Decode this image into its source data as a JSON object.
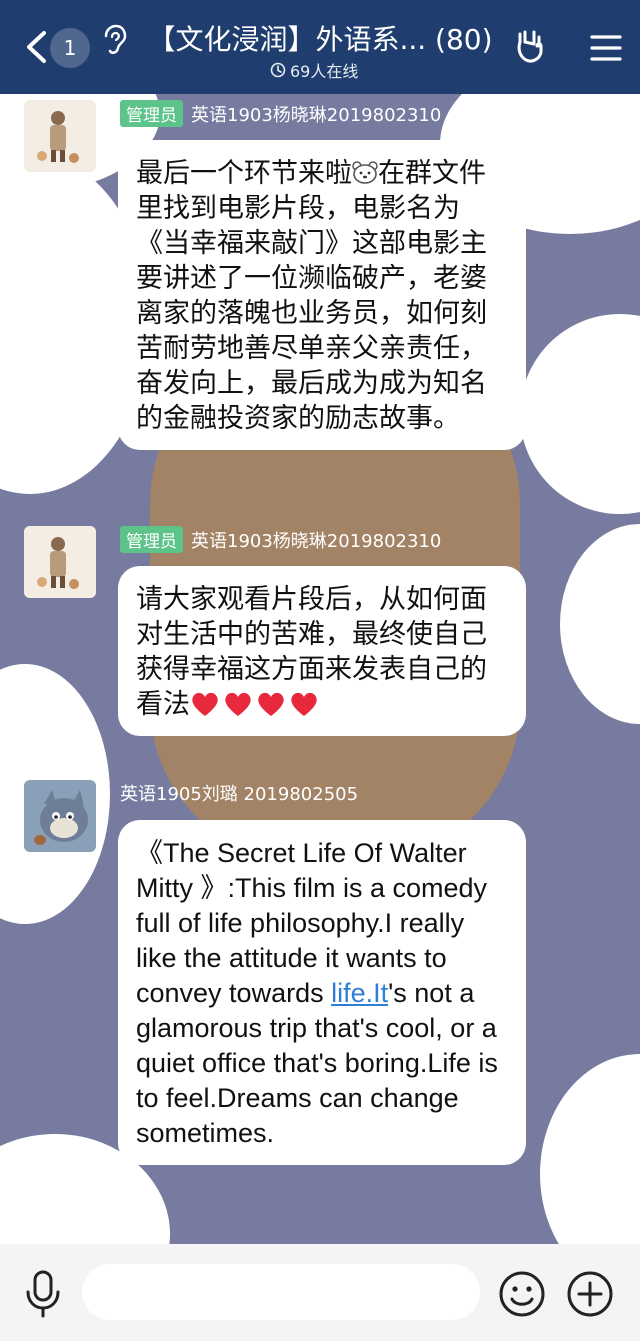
{
  "header": {
    "unread_count": "1",
    "title": "【文化浸润】外语系... (80)",
    "online_status": "69人在线"
  },
  "messages": [
    {
      "admin_badge": "管理员",
      "sender": "英语1903杨晓琳2019802310",
      "text_part1": "最后一个环节来啦",
      "text_part2": "在群文件里找到电影片段，电影名为《当幸福来敲门》这部电影主要讲述了一位濒临破产，老婆离家的落魄也业务员，如何刻苦耐劳地善尽单亲父亲责任，奋发向上，最后成为成为知名的金融投资家的励志故事。"
    },
    {
      "admin_badge": "管理员",
      "sender": "英语1903杨晓琳2019802310",
      "text": "请大家观看片段后，从如何面对生活中的苦难，最终使自己获得幸福这方面来发表自己的看法"
    },
    {
      "sender": "英语1905刘璐 2019802505",
      "text_part1": "《The Secret Life Of Walter Mitty 》:This film is a comedy full of life philosophy.I really like the attitude it wants to convey towards ",
      "link_text": "life.It",
      "text_part2": "'s not a glamorous trip that's cool, or a quiet office that's boring.Life is to feel.Dreams can change sometimes."
    }
  ],
  "input": {
    "placeholder": ""
  },
  "colors": {
    "header_bg": "#1f3e6f",
    "admin_badge": "#5cc488",
    "link": "#2f7fd6",
    "chat_bg": "#767b9f"
  },
  "icons": [
    "back-chevron-icon",
    "ear-icon",
    "clock-icon",
    "gesture-icon",
    "menu-icon",
    "mic-icon",
    "emoji-icon",
    "plus-icon",
    "heart-icon",
    "bear-emoji-icon"
  ]
}
